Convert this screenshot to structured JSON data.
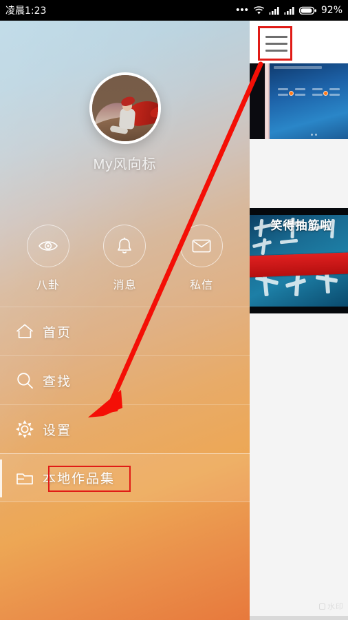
{
  "statusbar": {
    "time": "凌晨1:23",
    "overflow_icon": "•••",
    "wifi_icon": "wifi-icon",
    "signal1_icon": "signal-bars-icon",
    "signal2_icon": "signal-bars-icon",
    "battery_icon": "battery-icon",
    "battery_text": "92%"
  },
  "drawer": {
    "profile": {
      "avatar_icon": "avatar",
      "username": "My风向标"
    },
    "quick_actions": [
      {
        "label": "八卦",
        "icon": "eye-icon"
      },
      {
        "label": "消息",
        "icon": "bell-icon"
      },
      {
        "label": "私信",
        "icon": "envelope-icon"
      }
    ],
    "menu_items": [
      {
        "label": "首页",
        "icon": "home-icon",
        "active": false
      },
      {
        "label": "查找",
        "icon": "search-icon",
        "active": false
      },
      {
        "label": "设置",
        "icon": "gear-icon",
        "active": false
      },
      {
        "label": "本地作品集",
        "icon": "folder-icon",
        "active": true
      }
    ]
  },
  "right_panel": {
    "hamburger_icon": "hamburger-menu-icon",
    "thumbnails": [
      {
        "name": "phone-homescreen-thumbnail",
        "caption": ""
      },
      {
        "name": "video-cover-thumbnail",
        "caption": "笑得抽筋啦"
      }
    ],
    "watermark": "水印"
  },
  "annotations": {
    "arrow": "red-arrow-from-hamburger-to-menu-item",
    "highlight_boxes": [
      "hamburger-menu-icon",
      "本地作品集"
    ],
    "accent_color": "#e01b16"
  },
  "colors": {
    "drawer_top": "#b6d6e5",
    "drawer_mid": "#d8b89b",
    "drawer_bottom": "#e7793c",
    "panel_bg": "#f4f4f4",
    "statusbar_bg": "#000000",
    "annotation_red": "#e01b16"
  }
}
